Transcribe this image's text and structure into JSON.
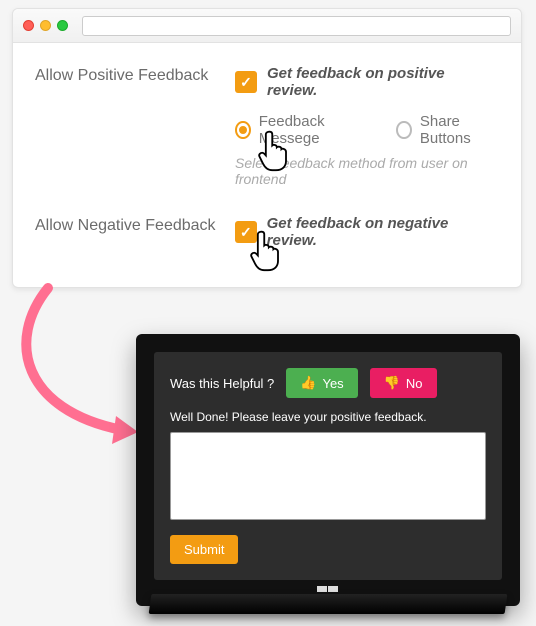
{
  "colors": {
    "accent": "#f39c12",
    "yes": "#4caf50",
    "no": "#e91e63"
  },
  "settings": {
    "positive": {
      "label": "Allow Positive Feedback",
      "checkbox_text": "Get feedback on positive review.",
      "radios": {
        "message": "Feedback Messege",
        "share": "Share Buttons"
      },
      "help": "Select feedback method from user on frontend"
    },
    "negative": {
      "label": "Allow Negative Feedback",
      "checkbox_text": "Get feedback on negative review."
    }
  },
  "widget": {
    "question": "Was this Helpful ?",
    "yes": "Yes",
    "no": "No",
    "prompt": "Well Done! Please leave your positive feedback.",
    "submit": "Submit"
  }
}
